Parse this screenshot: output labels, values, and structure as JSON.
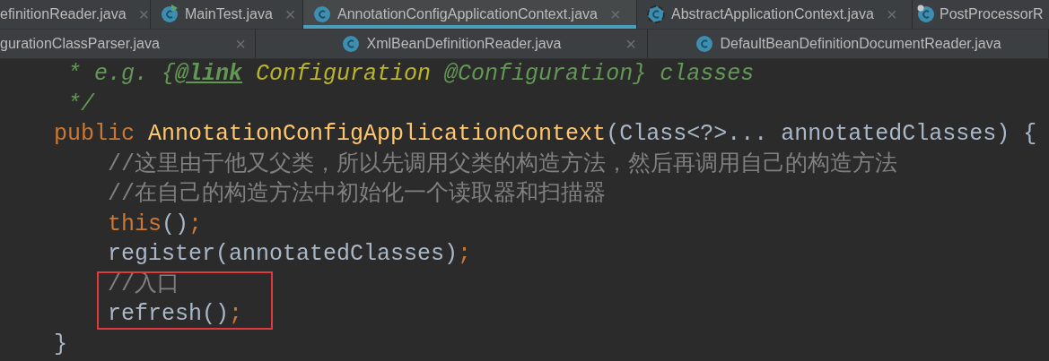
{
  "tab_rows": [
    [
      {
        "label": "efinitionReader.java",
        "kind": "plain",
        "selected": false,
        "closable": true
      },
      {
        "label": "MainTest.java",
        "kind": "runnable",
        "selected": false,
        "closable": true
      },
      {
        "label": "AnnotationConfigApplicationContext.java",
        "kind": "class",
        "selected": true,
        "closable": true
      },
      {
        "label": "AbstractApplicationContext.java",
        "kind": "abstract",
        "selected": false,
        "closable": true
      },
      {
        "label": "PostProcessorR",
        "kind": "pinned",
        "selected": false,
        "closable": false
      }
    ],
    [
      {
        "label": "gurationClassParser.java",
        "kind": "plain",
        "selected": false,
        "closable": true
      },
      {
        "label": "XmlBeanDefinitionReader.java",
        "kind": "class",
        "selected": false,
        "closable": true
      },
      {
        "label": "DefaultBeanDefinitionDocumentReader.java",
        "kind": "class",
        "selected": false,
        "closable": false
      }
    ]
  ],
  "close_glyph": "×",
  "code_lines": [
    {
      "highlighted": false,
      "tokens": [
        {
          "kind": "doc",
          "text": " * e.g. {"
        },
        {
          "kind": "doc-tag",
          "text": "@link"
        },
        {
          "kind": "doc-ref",
          "text": " Configuration"
        },
        {
          "kind": "doc",
          "text": " @Configuration} classes"
        }
      ]
    },
    {
      "highlighted": false,
      "tokens": [
        {
          "kind": "doc",
          "text": " */"
        }
      ]
    },
    {
      "highlighted": false,
      "tokens": [
        {
          "kind": "keyword",
          "text": "public "
        },
        {
          "kind": "method",
          "text": "AnnotationConfigApplicationContext"
        },
        {
          "kind": "plain",
          "text": "(Class<?>... annotatedClasses) {"
        }
      ]
    },
    {
      "highlighted": false,
      "tokens": [
        {
          "kind": "comment",
          "text": "    //这里由于他又父类，所以先调用父类的构造方法，然后再调用自己的构造方法"
        }
      ]
    },
    {
      "highlighted": false,
      "tokens": [
        {
          "kind": "comment",
          "text": "    //在自己的构造方法中初始化一个读取器和扫描器"
        }
      ]
    },
    {
      "highlighted": false,
      "tokens": [
        {
          "kind": "keyword",
          "text": "    this"
        },
        {
          "kind": "plain",
          "text": "()"
        },
        {
          "kind": "keyword",
          "text": ";"
        }
      ]
    },
    {
      "highlighted": false,
      "tokens": [
        {
          "kind": "plain",
          "text": "    register(annotatedClasses)"
        },
        {
          "kind": "keyword",
          "text": ";"
        }
      ]
    },
    {
      "highlighted": true,
      "tokens": [
        {
          "kind": "comment",
          "text": "    //入口"
        }
      ]
    },
    {
      "highlighted": true,
      "tokens": [
        {
          "kind": "plain",
          "text": "    refresh()"
        },
        {
          "kind": "keyword",
          "text": ";"
        }
      ]
    },
    {
      "highlighted": false,
      "tokens": [
        {
          "kind": "plain",
          "text": "}"
        }
      ]
    }
  ]
}
